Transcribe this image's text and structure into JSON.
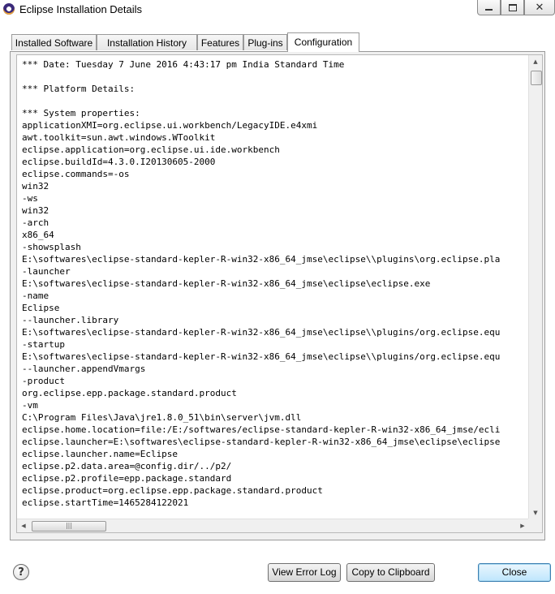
{
  "window": {
    "title": "Eclipse Installation Details",
    "minimize_icon": "minimize-icon",
    "maximize_icon": "maximize-icon",
    "close_glyph": "✕"
  },
  "tabs": [
    {
      "label": "Installed Software",
      "active": false
    },
    {
      "label": "Installation History",
      "active": false
    },
    {
      "label": "Features",
      "active": false
    },
    {
      "label": "Plug-ins",
      "active": false
    },
    {
      "label": "Configuration",
      "active": true
    }
  ],
  "configuration": {
    "lines": [
      "*** Date: Tuesday 7 June 2016 4:43:17 pm India Standard Time",
      "",
      "*** Platform Details:",
      "",
      "*** System properties:",
      "applicationXMI=org.eclipse.ui.workbench/LegacyIDE.e4xmi",
      "awt.toolkit=sun.awt.windows.WToolkit",
      "eclipse.application=org.eclipse.ui.ide.workbench",
      "eclipse.buildId=4.3.0.I20130605-2000",
      "eclipse.commands=-os",
      "win32",
      "-ws",
      "win32",
      "-arch",
      "x86_64",
      "-showsplash",
      "E:\\softwares\\eclipse-standard-kepler-R-win32-x86_64_jmse\\eclipse\\\\plugins\\org.eclipse.pla",
      "-launcher",
      "E:\\softwares\\eclipse-standard-kepler-R-win32-x86_64_jmse\\eclipse\\eclipse.exe",
      "-name",
      "Eclipse",
      "--launcher.library",
      "E:\\softwares\\eclipse-standard-kepler-R-win32-x86_64_jmse\\eclipse\\\\plugins/org.eclipse.equ",
      "-startup",
      "E:\\softwares\\eclipse-standard-kepler-R-win32-x86_64_jmse\\eclipse\\\\plugins/org.eclipse.equ",
      "--launcher.appendVmargs",
      "-product",
      "org.eclipse.epp.package.standard.product",
      "-vm",
      "C:\\Program Files\\Java\\jre1.8.0_51\\bin\\server\\jvm.dll",
      "eclipse.home.location=file:/E:/softwares/eclipse-standard-kepler-R-win32-x86_64_jmse/ecli",
      "eclipse.launcher=E:\\softwares\\eclipse-standard-kepler-R-win32-x86_64_jmse\\eclipse\\eclipse",
      "eclipse.launcher.name=Eclipse",
      "eclipse.p2.data.area=@config.dir/../p2/",
      "eclipse.p2.profile=epp.package.standard",
      "eclipse.product=org.eclipse.epp.package.standard.product",
      "eclipse.startTime=1465284122021"
    ]
  },
  "buttons": {
    "help": "?",
    "view_error_log": "View Error Log",
    "copy_to_clipboard": "Copy to Clipboard",
    "close": "Close"
  }
}
